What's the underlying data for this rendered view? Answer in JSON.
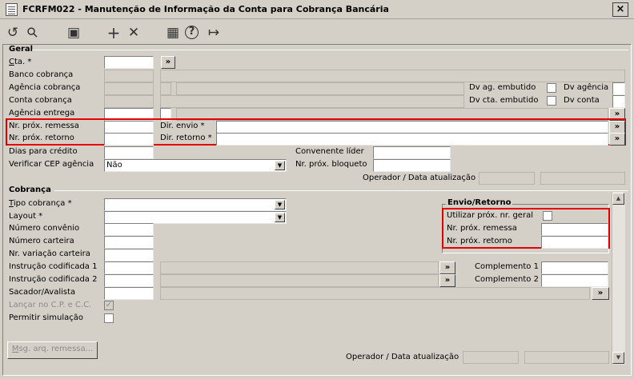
{
  "window": {
    "title": "FCRFM022 - Manutenção de Informação da Conta para Cobrança Bancária",
    "close": "×"
  },
  "toolbar": {
    "icons": [
      "undo-icon",
      "search-icon",
      "save-icon",
      "add-icon",
      "delete-icon",
      "calendar-icon",
      "help-icon",
      "exit-icon"
    ],
    "glyphs": {
      "undo": "↺",
      "search": "⚲",
      "save": "▣",
      "add": "+",
      "delete": "✕",
      "calendar": "▦",
      "help": "?",
      "exit": "↦"
    }
  },
  "geral": {
    "title": "Geral",
    "cta_label_pre": "C",
    "cta_label_post": "ta. *",
    "cta_value": "",
    "banco_label": "Banco cobrança",
    "agencia_label": "Agência cobrança",
    "conta_label": "Conta cobrança",
    "agencia_entrega_label": "Agência entrega",
    "nr_prox_remessa_label": "Nr. próx. remessa",
    "nr_prox_retorno_label": "Nr. próx. retorno",
    "dir_envio_label": "Dir. envio *",
    "dir_retorno_label": "Dir. retorno *",
    "dias_credito_label": "Dias para crédito",
    "verificar_cep_label": "Verificar CEP agência",
    "verificar_cep_value": "Não",
    "dv_ag_embutido_label": "Dv ag. embutido",
    "dv_agencia_label": "Dv agência",
    "dv_cta_embutido_label": "Dv cta. embutido",
    "dv_conta_label": "Dv conta",
    "convenente_lider_label": "Convenente líder",
    "nr_prox_bloqueto_label": "Nr. próx. bloqueto",
    "operador_label": "Operador / Data atualização",
    "lookup_label": "»"
  },
  "cobranca": {
    "title": "Cobrança",
    "tipo_cobranca_label_pre": "T",
    "tipo_cobranca_label_post": "ipo cobrança *",
    "layout_label": "Layout *",
    "numero_convenio_label": "Número convênio",
    "numero_carteira_label": "Número carteira",
    "nr_variacao_label": "Nr. variação carteira",
    "instrucao1_label": "Instrução codificada 1",
    "instrucao2_label": "Instrução codificada 2",
    "sacador_label": "Sacador/Avalista",
    "lancar_label": "Lançar no C.P. e C.C.",
    "permitir_label": "Permitir simulação",
    "complemento1_label": "Complemento 1",
    "complemento2_label": "Complemento 2",
    "msg_button_pre": "M",
    "msg_button_post": "sg. arq. remessa...",
    "operador_label": "Operador / Data atualização",
    "envio_retorno": {
      "title": "Envio/Retorno",
      "utilizar_label": "Utilizar próx. nr. geral",
      "nr_prox_remessa_label": "Nr. próx. remessa",
      "nr_prox_retorno_label": "Nr. próx. retorno"
    }
  },
  "colors": {
    "highlight": "#e00000",
    "background": "#d4d0c8"
  }
}
